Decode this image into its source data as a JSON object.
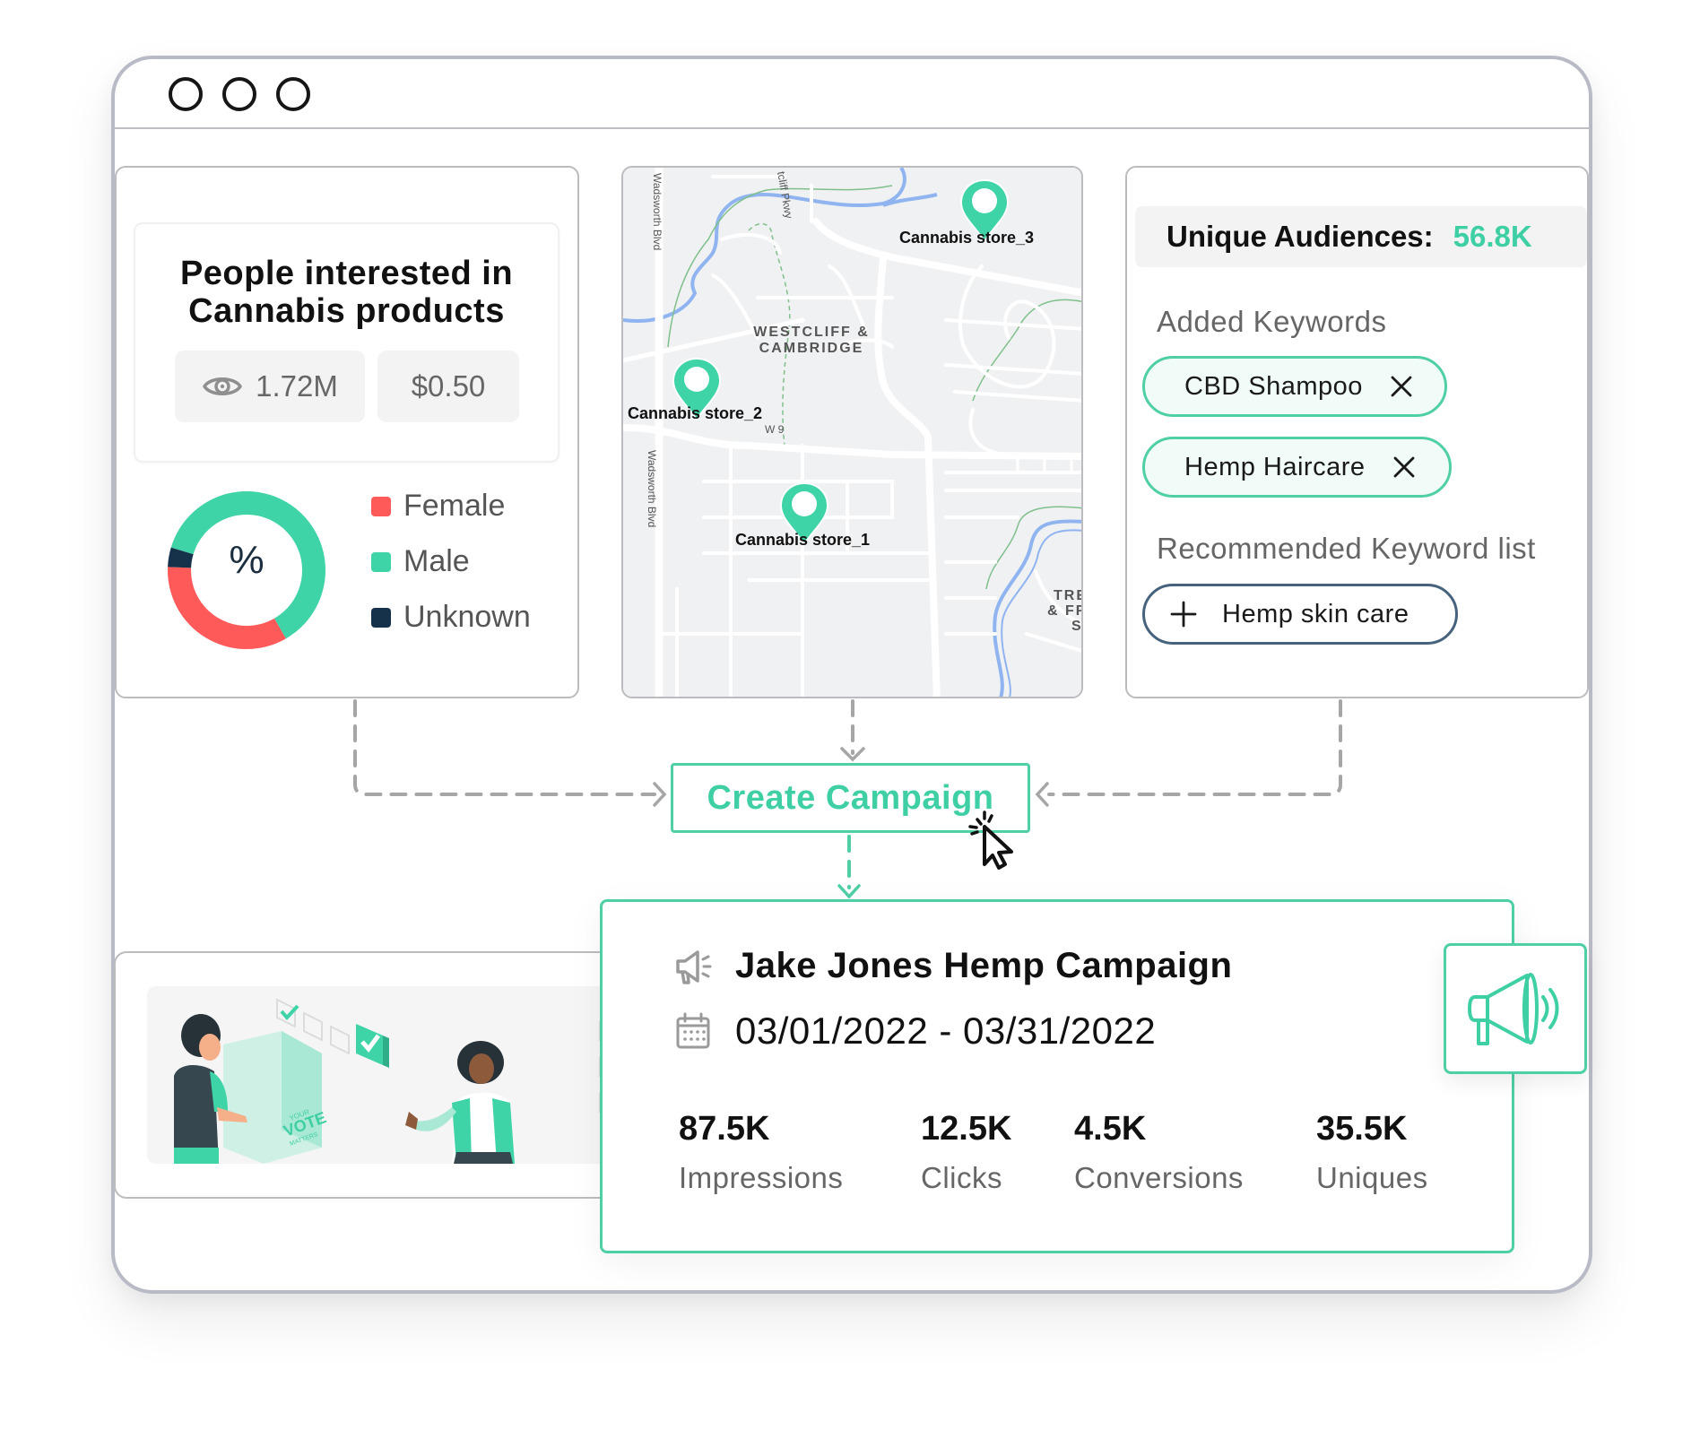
{
  "window": {
    "controls": [
      "close",
      "minimize",
      "maximize"
    ]
  },
  "audience": {
    "title_line1": "People interested in",
    "title_line2": "Cannabis products",
    "reach": "1.72M",
    "reach_icon": "eye-icon",
    "price": "$0.50",
    "donut_center": "%",
    "colors": {
      "female": "#ff5a5a",
      "male": "#3fd3a8",
      "unknown": "#16324a"
    }
  },
  "chart_data": {
    "type": "pie",
    "variant": "donut",
    "title": "%",
    "categories": [
      "Female",
      "Male",
      "Unknown"
    ],
    "values": [
      34,
      62,
      4
    ],
    "unit": "percent (estimated)",
    "legend_position": "right"
  },
  "map": {
    "neighborhood_label_line1": "WESTCLIFF &",
    "neighborhood_label_line2": "CAMBRIDGE",
    "partial_label_line1": "TRE",
    "partial_label_line2": "& FF",
    "partial_label_line3": "S",
    "road_labels": [
      "Wadsworth Blvd",
      "Wadsworth Blvd",
      "tcliff Pkwy",
      "W 9"
    ],
    "stores": [
      {
        "label": "Cannabis store_3"
      },
      {
        "label": "Cannabis store_2"
      },
      {
        "label": "Cannabis store_1"
      }
    ],
    "pin_color": "#3fd3a8"
  },
  "keywords": {
    "unique_audiences_label": "Unique Audiences:",
    "unique_audiences_value": "56.8K",
    "added_label": "Added Keywords",
    "added": [
      {
        "label": "CBD Shampoo",
        "action": "remove"
      },
      {
        "label": "Hemp Haircare",
        "action": "remove"
      }
    ],
    "recommended_label": "Recommended Keyword list",
    "recommended": [
      {
        "label": "Hemp skin care",
        "action": "add"
      }
    ]
  },
  "create_button": {
    "label": "Create Campaign"
  },
  "illustration": {
    "text_line1": "YOUR",
    "text_line2": "VOTE",
    "text_line3": "MATTERS"
  },
  "campaign": {
    "name": "Jake Jones Hemp Campaign",
    "dates": "03/01/2022 - 03/31/2022",
    "metrics": [
      {
        "value": "87.5K",
        "label": "Impressions"
      },
      {
        "value": "12.5K",
        "label": "Clicks"
      },
      {
        "value": "4.5K",
        "label": "Conversions"
      },
      {
        "value": "35.5K",
        "label": "Uniques"
      }
    ],
    "accent_color": "#3fcfa4"
  }
}
